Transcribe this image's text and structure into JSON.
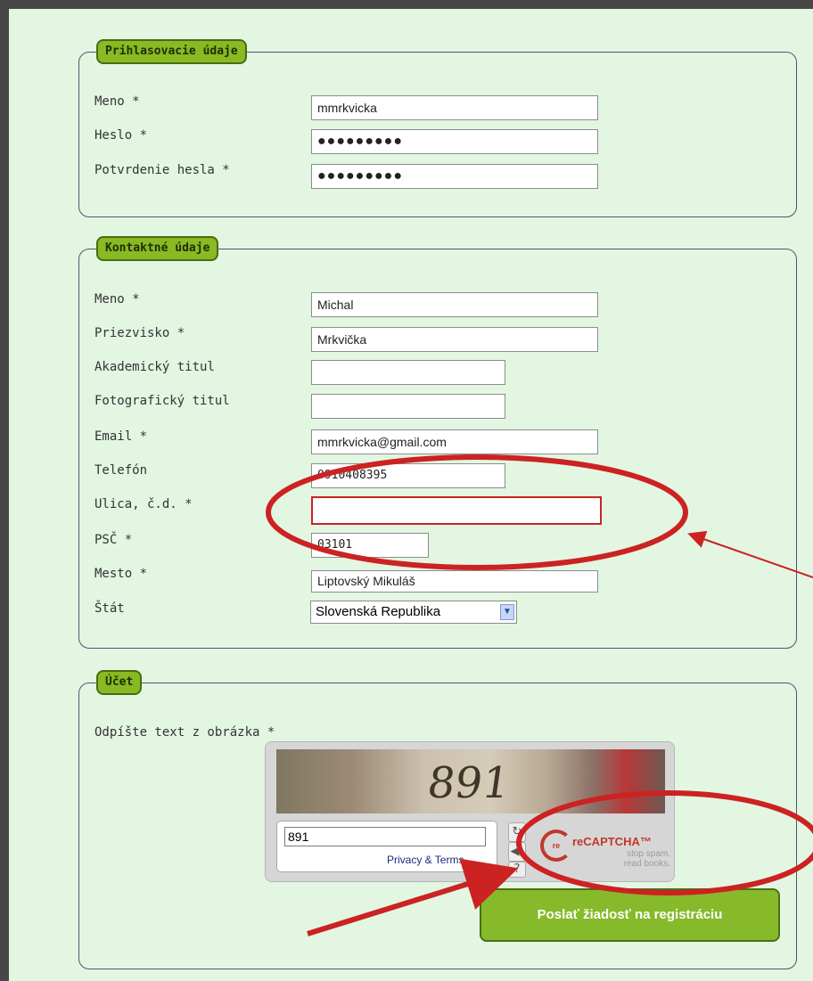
{
  "login": {
    "legend": "Prihlasovacie údaje",
    "username_label": "Meno *",
    "username_value": "mmrkvicka",
    "password_label": "Heslo *",
    "password_value": "●●●●●●●●●",
    "confirm_label": "Potvrdenie hesla *",
    "confirm_value": "●●●●●●●●●"
  },
  "contact": {
    "legend": "Kontaktné údaje",
    "first_name_label": "Meno *",
    "first_name_value": "Michal",
    "surname_label": "Priezvisko *",
    "surname_value": "Mrkvička",
    "academic_label": "Akademický titul",
    "academic_value": "",
    "photo_label": "Fotografický titul",
    "photo_value": "",
    "email_label": "Email *",
    "email_value": "mmrkvicka@gmail.com",
    "phone_label": "Telefón",
    "phone_value": "0910408395",
    "street_label": "Ulica, č.d. *",
    "street_value": "",
    "zip_label": "PSČ *",
    "zip_value": "03101",
    "city_label": "Mesto *",
    "city_value": "Liptovský Mikuláš",
    "country_label": "Štát",
    "country_value": "Slovenská Republika"
  },
  "account": {
    "legend": "Účet",
    "captcha_label": "Odpíšte text z obrázka *",
    "captcha_image_text": "891",
    "captcha_input_value": "891",
    "privacy_link": "Privacy & Terms",
    "recaptcha_brand": "reCAPTCHA™",
    "recaptcha_tagline_1": "stop spam.",
    "recaptcha_tagline_2": "read books.",
    "submit_label": "Poslať žiadosť na registráciu"
  },
  "icons": {
    "refresh": "refresh-icon",
    "audio": "audio-icon",
    "help": "help-icon",
    "dropdown": "chevron-down-icon"
  },
  "colors": {
    "page_bg": "#e2f6e2",
    "legend_bg": "#89b923",
    "annotation_red": "#cc2222",
    "outer_bg": "#474747"
  }
}
